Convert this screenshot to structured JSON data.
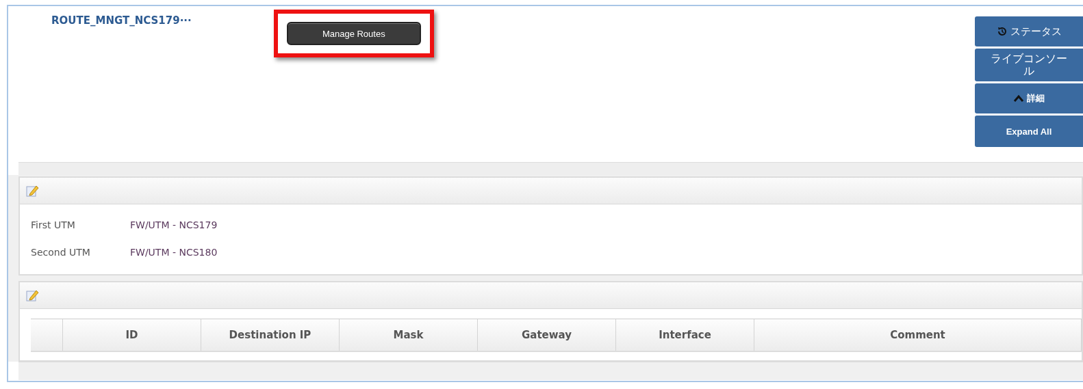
{
  "page": {
    "title": "ROUTE_MNGT_NCS179···"
  },
  "manage_button": {
    "label": "Manage Routes",
    "highlighted": true
  },
  "side_buttons": [
    {
      "kind": "history",
      "label": "ステータス"
    },
    {
      "kind": "plain",
      "label": "ライブコンソール"
    },
    {
      "kind": "collapse",
      "label": "詳細"
    },
    {
      "kind": "plain",
      "label": "Expand All"
    }
  ],
  "utm_panel": {
    "fields": [
      {
        "label": "First UTM",
        "value": "FW/UTM - NCS179"
      },
      {
        "label": "Second UTM",
        "value": "FW/UTM - NCS180"
      }
    ]
  },
  "routes_panel": {
    "table": {
      "columns": [
        "ID",
        "Destination IP",
        "Mask",
        "Gateway",
        "Interface",
        "Comment"
      ]
    }
  }
}
